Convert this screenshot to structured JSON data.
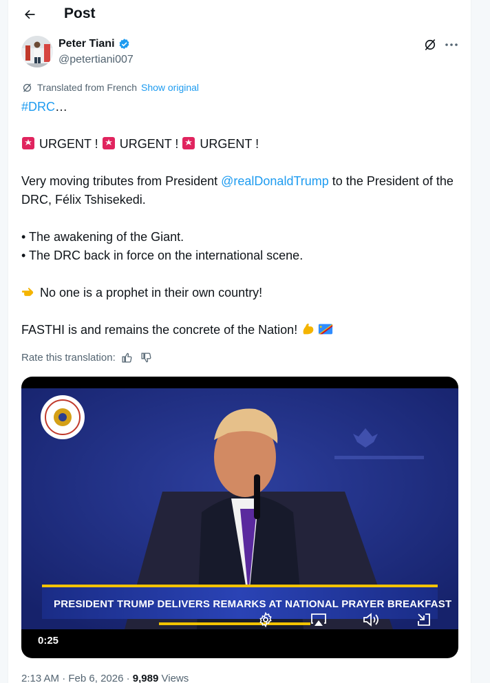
{
  "header": {
    "title": "Post"
  },
  "author": {
    "name": "Peter Tiani",
    "handle": "@petertiani007"
  },
  "translation": {
    "label": "Translated from French",
    "show_original": "Show original"
  },
  "post": {
    "hashtag": "#DRC",
    "ellipsis": "…",
    "urgent": [
      "URGENT !",
      "URGENT !",
      "URGENT !"
    ],
    "tribute_pre": "Very moving tributes from President ",
    "mention": "@realDonaldTrump",
    "tribute_post": " to the President of the DRC, Félix Tshisekedi.",
    "bullet1": "• The awakening of the Giant.",
    "bullet2": "• The DRC back in force on the international scene.",
    "prophet": " No one is a prophet in their own country!",
    "fasthi": "FASTHI is and remains the concrete of the Nation! "
  },
  "rate": {
    "label": "Rate this translation:"
  },
  "video": {
    "lower_third": "PRESIDENT TRUMP DELIVERS REMARKS AT NATIONAL PRAYER BREAKFAST",
    "time": "0:25"
  },
  "meta": {
    "time": "2:13 AM",
    "separator": " · ",
    "date": "Feb 6, 2026",
    "views_count": "9,989",
    "views_label": " Views"
  },
  "colors": {
    "accent": "#1d9bf0",
    "secondary_text": "#536471"
  },
  "icons": [
    "back-arrow-icon",
    "verified-badge-icon",
    "grok-icon",
    "more-icon",
    "translate-icon",
    "thumbs-up-icon",
    "thumbs-down-icon",
    "settings-icon",
    "airplay-icon",
    "volume-icon",
    "minimize-icon"
  ]
}
